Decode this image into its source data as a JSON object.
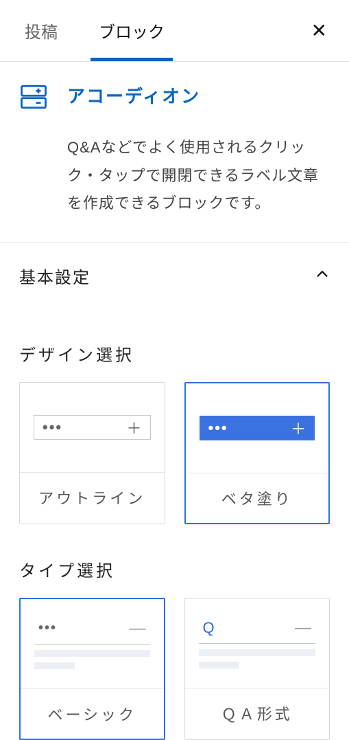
{
  "tabs": {
    "post": "投稿",
    "block": "ブロック"
  },
  "block": {
    "title": "アコーディオン",
    "description": "Q&Aなどでよく使用されるクリック・タップで開閉できるラベル文章を作成できるブロックです。"
  },
  "sections": {
    "basic": {
      "title": "基本設定",
      "design": {
        "title": "デザイン選択",
        "options": [
          {
            "label": "アウトライン"
          },
          {
            "label": "ベタ塗り"
          }
        ],
        "selected": 1
      },
      "type": {
        "title": "タイプ選択",
        "options": [
          {
            "label": "ベーシック"
          },
          {
            "label": "ＱＡ形式"
          }
        ],
        "selected": 0,
        "qa_glyph": "Q"
      }
    }
  },
  "icons": {
    "close": "✕",
    "dots": "•••",
    "plus": "＋",
    "minus": "—"
  }
}
